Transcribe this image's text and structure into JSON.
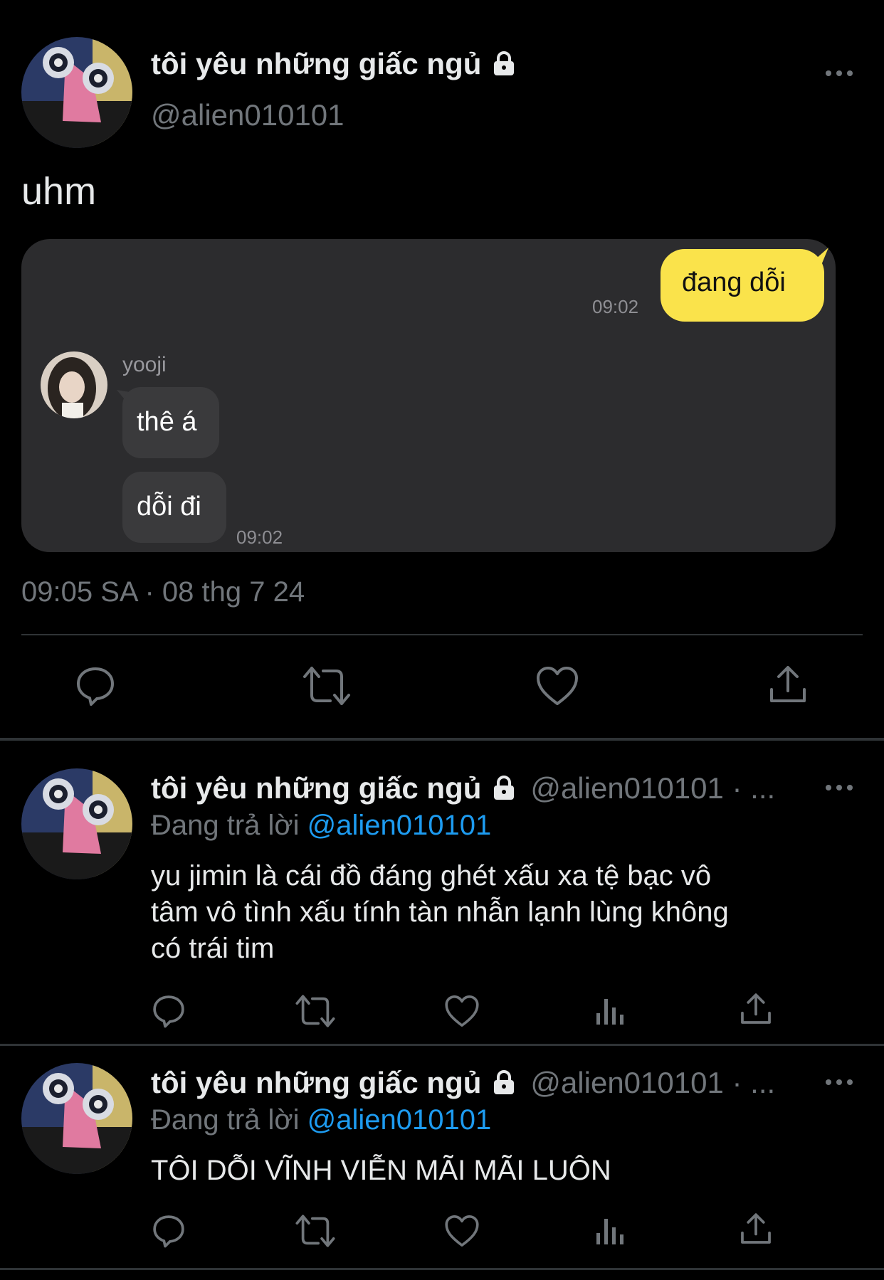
{
  "main_tweet": {
    "display_name": "tôi yêu những giấc ngủ",
    "handle": "@alien010101",
    "text": "uhm",
    "timestamp": "09:05 SA · 08 thg 7 24",
    "chat": {
      "sent_message": "đang dỗi",
      "sent_time": "09:02",
      "other_name": "yooji",
      "received_messages": [
        "thê á",
        "dỗi đi"
      ],
      "received_time": "09:02"
    }
  },
  "replies": [
    {
      "display_name": "tôi yêu những giấc ngủ",
      "handle_time": "@alien010101 · ...",
      "replying_label": "Đang trả lời",
      "replying_to": "@alien010101",
      "text_lines": [
        "yu jimin là cái đồ đáng ghét xấu xa tệ bạc vô",
        "tâm vô tình xấu tính tàn nhẫn lạnh lùng không",
        "có trái tim"
      ]
    },
    {
      "display_name": "tôi yêu những giấc ngủ",
      "handle_time": "@alien010101 · ...",
      "replying_label": "Đang trả lời",
      "replying_to": "@alien010101",
      "text_lines": [
        "TÔI DỖI VĨNH VIỄN MÃI MÃI LUÔN"
      ]
    }
  ],
  "icons": {
    "lock": "lock-icon",
    "more": "more-icon",
    "reply": "reply-icon",
    "retweet": "retweet-icon",
    "like": "heart-icon",
    "views": "views-icon",
    "share": "share-icon"
  },
  "colors": {
    "background": "#000000",
    "sent_bubble": "#fae34b",
    "chat_card": "#2c2c2e",
    "mention": "#1d9bf0",
    "muted": "#71767b"
  }
}
